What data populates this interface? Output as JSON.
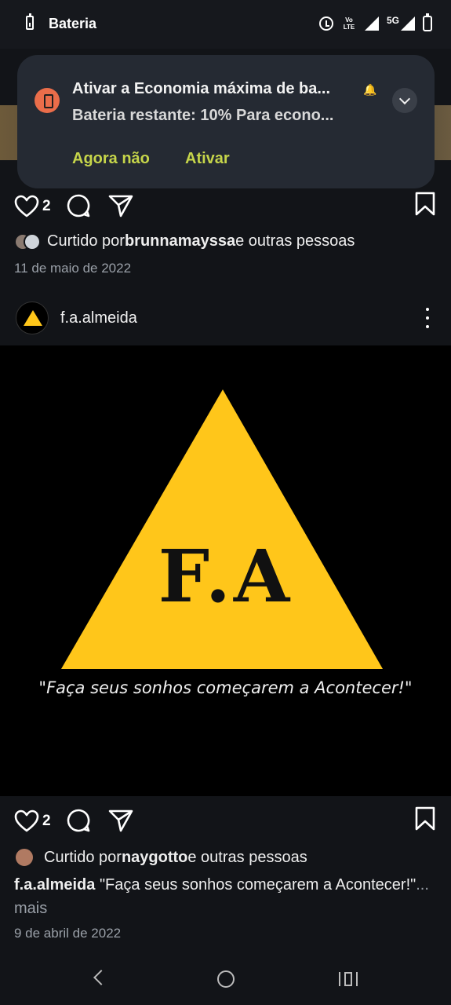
{
  "status_bar": {
    "title": "Bateria",
    "network": "5G",
    "volte": "Vo LTE",
    "icons": [
      "battery-icon",
      "alarm-icon",
      "volte-icon",
      "signal-icon",
      "battery-icon"
    ]
  },
  "notification": {
    "title": "Ativar a Economia máxima de ba...",
    "text": "Bateria restante: 10% Para econo...",
    "button_later": "Agora não",
    "button_activate": "Ativar",
    "accent_color": "#c6d54a",
    "icon_color": "#ea6d4a"
  },
  "post1": {
    "likes": "2",
    "liked_by_prefix": "Curtido por ",
    "liked_by_user": "brunnamayssa",
    "liked_by_suffix": " e outras pessoas",
    "date": "11 de maio de 2022"
  },
  "post2": {
    "username": "f.a.almeida",
    "image": {
      "logo_text": "F.A",
      "quote": "\"Faça seus sonhos começarem a Acontecer!\"",
      "triangle_color": "#ffc61a"
    },
    "likes": "2",
    "liked_by_prefix": "Curtido por ",
    "liked_by_user": "naygotto",
    "liked_by_suffix": " e outras pessoas",
    "caption_user": "f.a.almeida",
    "caption_text": " \"Faça seus sonhos começarem a Acontecer!\"",
    "caption_more": "... mais",
    "date": "9 de abril de 2022"
  }
}
